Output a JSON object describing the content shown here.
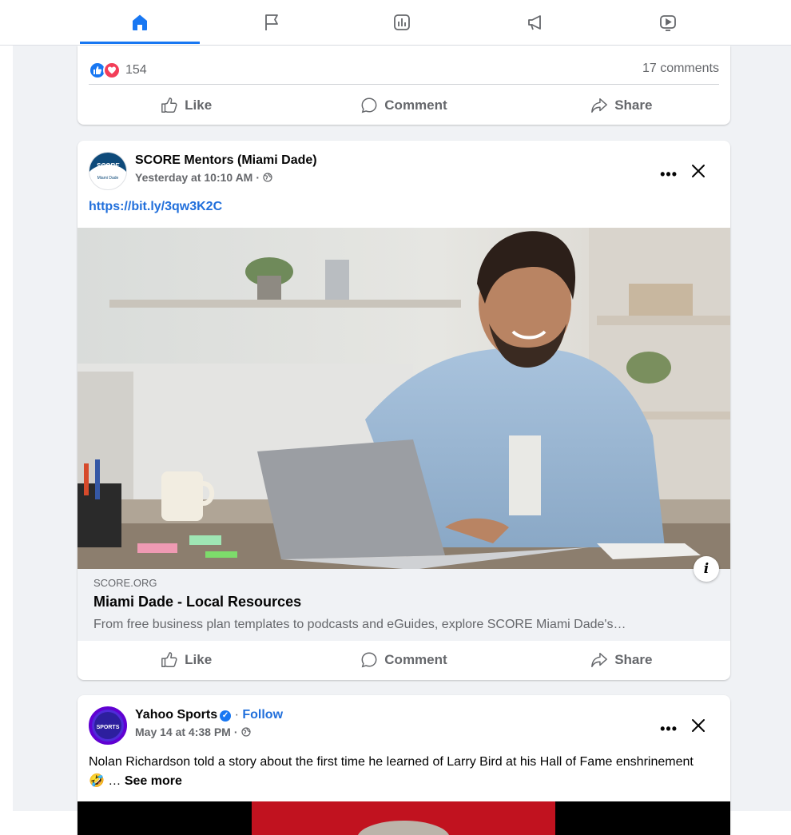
{
  "nav": {
    "tabs": [
      {
        "icon": "home-icon",
        "active": true
      },
      {
        "icon": "flag-icon",
        "active": false
      },
      {
        "icon": "analytics-icon",
        "active": false
      },
      {
        "icon": "megaphone-icon",
        "active": false
      },
      {
        "icon": "video-icon",
        "active": false
      }
    ]
  },
  "post1": {
    "reaction_count": "154",
    "comments": "17 comments",
    "like_label": "Like",
    "comment_label": "Comment",
    "share_label": "Share"
  },
  "post2": {
    "author": "SCORE Mentors (Miami Dade)",
    "timestamp": "Yesterday at 10:10 AM",
    "dot": "·",
    "link": "https://bit.ly/3qw3K2C",
    "avatar_text_top": "SCORE",
    "avatar_text_bottom": "Miami Dade",
    "preview": {
      "domain": "SCORE.ORG",
      "title": "Miami Dade - Local Resources",
      "description": "From free business plan templates to podcasts and eGuides, explore SCORE Miami Dade's…"
    },
    "more": "•••",
    "info_glyph": "i",
    "like_label": "Like",
    "comment_label": "Comment",
    "share_label": "Share"
  },
  "post3": {
    "author": "Yahoo Sports",
    "dot": "·",
    "follow": "Follow",
    "timestamp": "May 14 at 4:38 PM",
    "avatar_text": "SPORTS",
    "text": "Nolan Richardson told a story about the first time he learned of Larry Bird at his Hall of Fame enshrinement",
    "emoji": "🤣",
    "ellipsis": "…",
    "see_more": "See more",
    "more": "•••"
  },
  "colors": {
    "accent": "#1877f2",
    "link": "#216fdb",
    "muted": "#65676b",
    "feed_bg": "#f0f2f5",
    "love": "#f33e58"
  }
}
